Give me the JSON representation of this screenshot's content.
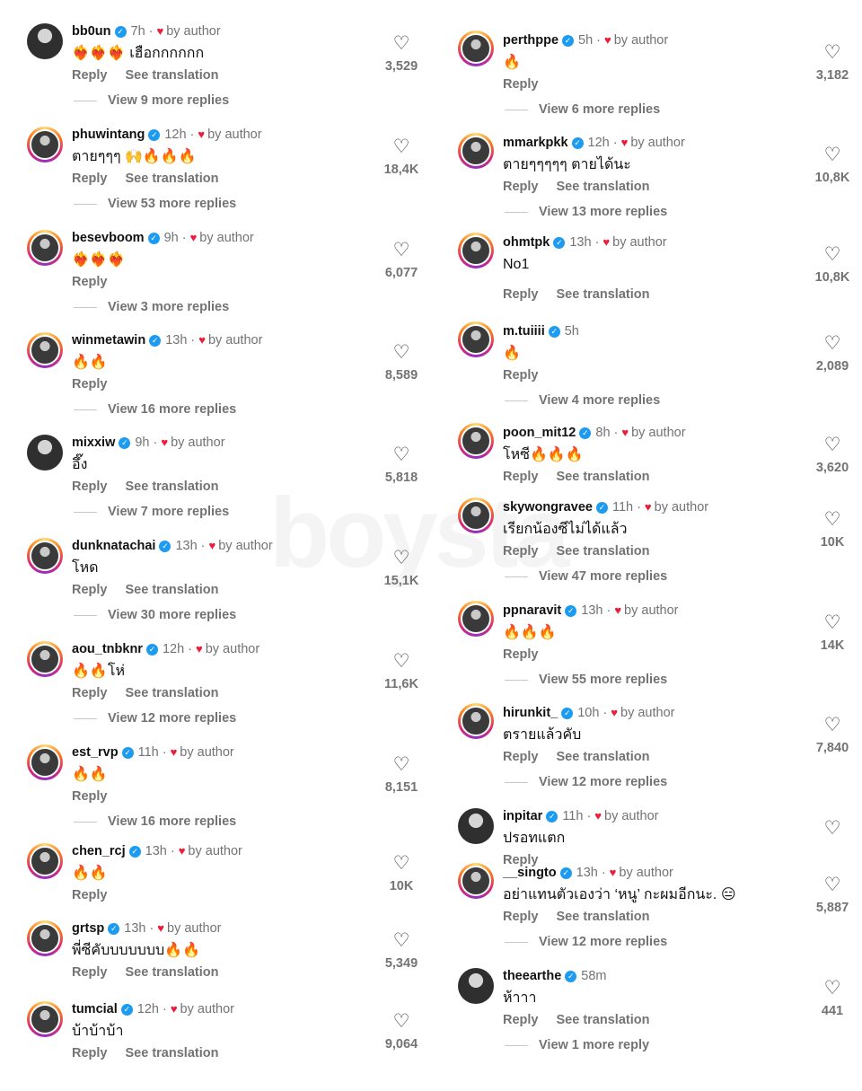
{
  "common": {
    "by_author": "by author",
    "reply": "Reply",
    "see_translation": "See translation",
    "dot": "·"
  },
  "watermark": "boysta",
  "left": [
    {
      "username": "bb0un",
      "time": "7h",
      "author": true,
      "text": "❤️‍🔥❤️‍🔥❤️‍🔥 เฮือกกกกกก",
      "translate": true,
      "likes": "3,529",
      "more": "View 9 more replies",
      "ring": false
    },
    {
      "username": "phuwintang",
      "time": "12h",
      "author": true,
      "text": "ตายๆๆๆ 🙌🔥🔥🔥",
      "translate": true,
      "likes": "18,4K",
      "more": "View 53 more replies",
      "ring": true
    },
    {
      "username": "besevboom",
      "time": "9h",
      "author": true,
      "text": "❤️‍🔥❤️‍🔥❤️‍🔥",
      "translate": false,
      "likes": "6,077",
      "more": "View 3 more replies",
      "ring": true
    },
    {
      "username": "winmetawin",
      "time": "13h",
      "author": true,
      "text": "🔥🔥",
      "translate": false,
      "likes": "8,589",
      "more": "View 16 more replies",
      "ring": true
    },
    {
      "username": "mixxiw",
      "time": "9h",
      "author": true,
      "text": "อึ๊ง",
      "translate": true,
      "likes": "5,818",
      "more": "View 7 more replies",
      "ring": false
    },
    {
      "username": "dunknatachai",
      "time": "13h",
      "author": true,
      "text": "โหด",
      "translate": true,
      "likes": "15,1K",
      "more": "View 30 more replies",
      "ring": true
    },
    {
      "username": "aou_tnbknr",
      "time": "12h",
      "author": true,
      "text": "🔥🔥โห่",
      "translate": true,
      "likes": "11,6K",
      "more": "View 12 more replies",
      "ring": true
    },
    {
      "username": "est_rvp",
      "time": "11h",
      "author": true,
      "text": "🔥🔥",
      "translate": false,
      "likes": "8,151",
      "more": "View 16 more replies",
      "ring": true
    },
    {
      "username": "chen_rcj",
      "time": "13h",
      "author": true,
      "text": "🔥🔥",
      "translate": false,
      "likes": "10K",
      "more": "",
      "ring": true
    },
    {
      "username": "grtsp",
      "time": "13h",
      "author": true,
      "text": "พี่ซีคับบบบบบบ🔥🔥",
      "translate": true,
      "likes": "5,349",
      "more": "",
      "ring": true
    },
    {
      "username": "tumcial",
      "time": "12h",
      "author": true,
      "text": "บ้าบ้าบ้า",
      "translate": true,
      "likes": "9,064",
      "more": "",
      "ring": true
    }
  ],
  "right": [
    {
      "username": "perthppe",
      "time": "5h",
      "author": true,
      "text": "🔥",
      "translate": false,
      "likes": "3,182",
      "more": "View 6 more replies",
      "ring": true
    },
    {
      "username": "mmarkpkk",
      "time": "12h",
      "author": true,
      "text": "ตายๆๆๆๆๆ ตายได้นะ",
      "translate": true,
      "likes": "10,8K",
      "more": "View 13 more replies",
      "ring": true
    },
    {
      "username": "ohmtpk",
      "time": "13h",
      "author": true,
      "text": "No1",
      "translate": true,
      "likes": "10,8K",
      "more": "",
      "ring": true
    },
    {
      "username": "m.tuiiii",
      "time": "5h",
      "author": false,
      "text": "🔥",
      "translate": false,
      "likes": "2,089",
      "more": "View 4 more replies",
      "ring": true
    },
    {
      "username": "poon_mit12",
      "time": "8h",
      "author": true,
      "text": "โหซี🔥🔥🔥",
      "translate": true,
      "likes": "3,620",
      "more": "",
      "ring": true
    },
    {
      "username": "skywongravee",
      "time": "11h",
      "author": true,
      "text": "เรียกน้องซีไม่ได้แล้ว",
      "translate": true,
      "likes": "10K",
      "more": "View 47 more replies",
      "ring": true
    },
    {
      "username": "ppnaravit",
      "time": "13h",
      "author": true,
      "text": "🔥🔥🔥",
      "translate": false,
      "likes": "14K",
      "more": "View 55 more replies",
      "ring": true
    },
    {
      "username": "hirunkit_",
      "time": "10h",
      "author": true,
      "text": "ตรายแล้วคับ",
      "translate": true,
      "likes": "7,840",
      "more": "View 12 more replies",
      "ring": true
    },
    {
      "username": "inpitar",
      "time": "11h",
      "author": true,
      "text": "ปรอทแตก",
      "translate": false,
      "likes": "",
      "more": "",
      "ring": false
    },
    {
      "username": "__singto",
      "time": "13h",
      "author": true,
      "text": "อย่าแทนตัวเองว่า ‘หนู’ กะผมอีกนะ. 😑",
      "translate": true,
      "likes": "5,887",
      "more": "View 12 more replies",
      "ring": true
    },
    {
      "username": "theearthe",
      "time": "58m",
      "author": false,
      "text": "ห้าาา",
      "translate": true,
      "likes": "441",
      "more": "View 1 more reply",
      "ring": false
    }
  ]
}
